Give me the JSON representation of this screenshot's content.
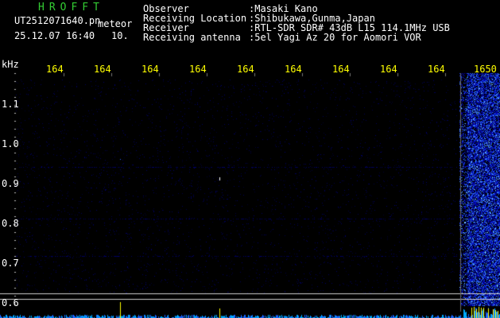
{
  "header": {
    "app_name": "HROFFT",
    "file_name": "UT2512071640.pn",
    "file_suffix": "meteor",
    "date_time": "25.12.07 16:40",
    "interval": "10.",
    "fields": [
      {
        "label": "Observer",
        "value": ":Masaki Kano"
      },
      {
        "label": "Receiving Location",
        "value": ":Shibukawa,Gunma,Japan"
      },
      {
        "label": "Receiver",
        "value": ":RTL-SDR SDR# 43dB L15 114.1MHz USB"
      },
      {
        "label": "Receiving antenna",
        "value": ":5el Yagi Az 20 for Aomori VOR"
      }
    ]
  },
  "axes": {
    "y_unit": "kHz",
    "y_ticks": [
      "1.1",
      "1.0",
      "0.9",
      "0.8",
      "0.7",
      "0.6"
    ],
    "time_ticks": [
      "164",
      "164",
      "164",
      "164",
      "164",
      "164",
      "164",
      "164",
      "164",
      "1650"
    ]
  },
  "colors": {
    "title": "#33cc33",
    "text": "#ffffff",
    "time_labels": "#ffff00",
    "signal": "#3366ff"
  }
}
